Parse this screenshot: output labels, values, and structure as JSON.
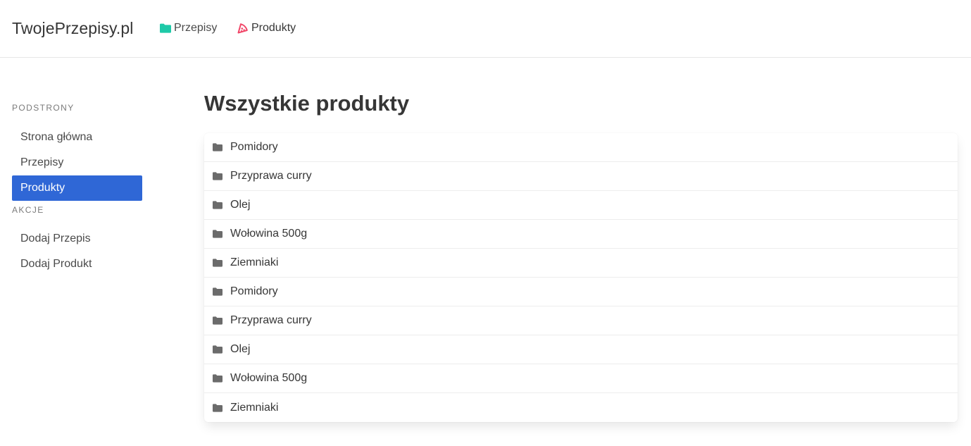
{
  "navbar": {
    "brand": "TwojePrzepisy.pl",
    "links": [
      {
        "label": "Przepisy",
        "icon": "folder-icon",
        "icon_color": "#1ec9a8"
      },
      {
        "label": "Produkty",
        "icon": "pizza-icon",
        "icon_color": "#f14668"
      }
    ]
  },
  "sidebar": {
    "sections": [
      {
        "label": "Podstrony",
        "items": [
          {
            "label": "Strona główna",
            "active": false
          },
          {
            "label": "Przepisy",
            "active": false
          },
          {
            "label": "Produkty",
            "active": true
          }
        ]
      },
      {
        "label": "Akcje",
        "items": [
          {
            "label": "Dodaj Przepis",
            "active": false
          },
          {
            "label": "Dodaj Produkt",
            "active": false
          }
        ]
      }
    ]
  },
  "main": {
    "title": "Wszystkie produkty",
    "products": [
      {
        "name": "Pomidory"
      },
      {
        "name": "Przyprawa curry"
      },
      {
        "name": "Olej"
      },
      {
        "name": "Wołowina 500g"
      },
      {
        "name": "Ziemniaki"
      },
      {
        "name": "Pomidory"
      },
      {
        "name": "Przyprawa curry"
      },
      {
        "name": "Olej"
      },
      {
        "name": "Wołowina 500g"
      },
      {
        "name": "Ziemniaki"
      }
    ]
  },
  "colors": {
    "accent": "#2f67d6",
    "folder_icon": "#6b6b6b"
  }
}
